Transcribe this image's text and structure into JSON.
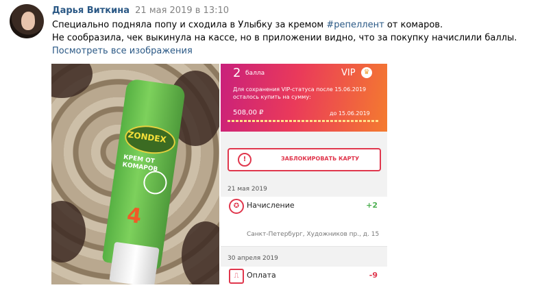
{
  "post": {
    "author": "Дарья Виткина",
    "date": "21 мая 2019 в 13:10",
    "line1_before": "Специально подняла попу и сходила в Улыбку за кремом ",
    "hashtag": "#репеллент",
    "line1_after": " от комаров.",
    "line2": "Не сообразила, чек выкинула на кассе, но в приложении видно, что за покупку начислили баллы.",
    "show_all": "Посмотреть все изображения"
  },
  "photo": {
    "brand": "ZONDEX",
    "product": "КРЕМ ОТ КОМАРОВ",
    "hours": "4"
  },
  "app": {
    "points_num": "2",
    "points_label": "балла",
    "vip": "VIP",
    "crown": "♛",
    "status_text": "Для сохранения VIP-статуса после 15.06.2019 осталось купить на сумму:",
    "sum": "508,00 ₽",
    "until": "до 15.06.2019",
    "progress": 0.0,
    "block_button": "ЗАБЛОКИРОВАТЬ КАРТУ",
    "transactions": [
      {
        "date": "21 мая 2019",
        "title": "Начисление",
        "amount": "+2",
        "amount_color": "#4caf50",
        "address": "Санкт-Петербург, Художников пр., д. 15"
      },
      {
        "date": "30 апреля 2019",
        "title": "Оплата",
        "amount": "-9",
        "amount_color": "#e0364c"
      }
    ]
  }
}
